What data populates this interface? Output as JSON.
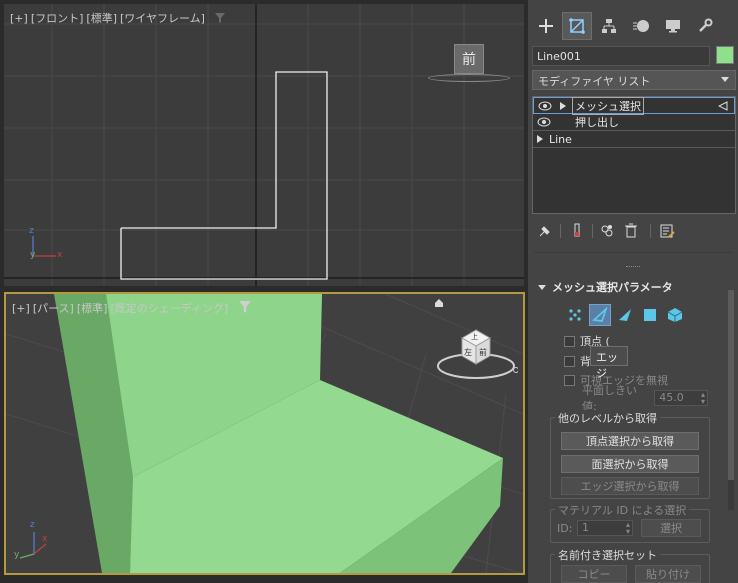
{
  "front_viewport": {
    "label_parts": [
      "[+]",
      "[フロント]",
      "[標準]",
      "[ワイヤフレーム]"
    ],
    "viewcube_label": "前"
  },
  "persp_viewport": {
    "label_parts": [
      "[+]",
      "[パース]",
      "[標準]",
      "[既定のシェーディング]"
    ],
    "viewcube_faces": [
      "左",
      "前",
      "上"
    ]
  },
  "axes": {
    "x": "x",
    "y": "y",
    "z": "z"
  },
  "panel": {
    "object_name": "Line001",
    "object_color": "#8ee08a",
    "modifier_list": "モディファイヤ リスト",
    "stack": [
      {
        "label": "メッシュ選択",
        "selected": true
      },
      {
        "label": "押し出し",
        "selected": false
      },
      {
        "label": "Line",
        "selected": false
      }
    ],
    "rollout_title": "メッシュ選択パラメータ",
    "checkbox_vertex": "頂点 (",
    "checkbox_back": "背",
    "tooltip": "エッジ",
    "checkbox_ignore_visible": "可視エッジを無視",
    "planar_label": "平面しきい値:",
    "planar_value": "45.0",
    "group_get": {
      "title": "他のレベルから取得",
      "btn_vertex": "頂点選択から取得",
      "btn_face": "面選択から取得",
      "btn_edge": "エッジ選択から取得"
    },
    "group_material": {
      "title": "マテリアル ID による選択",
      "id_label": "ID:",
      "id_value": "1",
      "btn_select": "選択"
    },
    "group_named": {
      "title": "名前付き選択セット",
      "btn_copy": "コピー",
      "btn_paste": "貼り付け"
    }
  },
  "colors": {
    "selection_blue": "#5a7fa8",
    "viewport_border": "#b59a3d",
    "object_green": "#8ee08a"
  }
}
